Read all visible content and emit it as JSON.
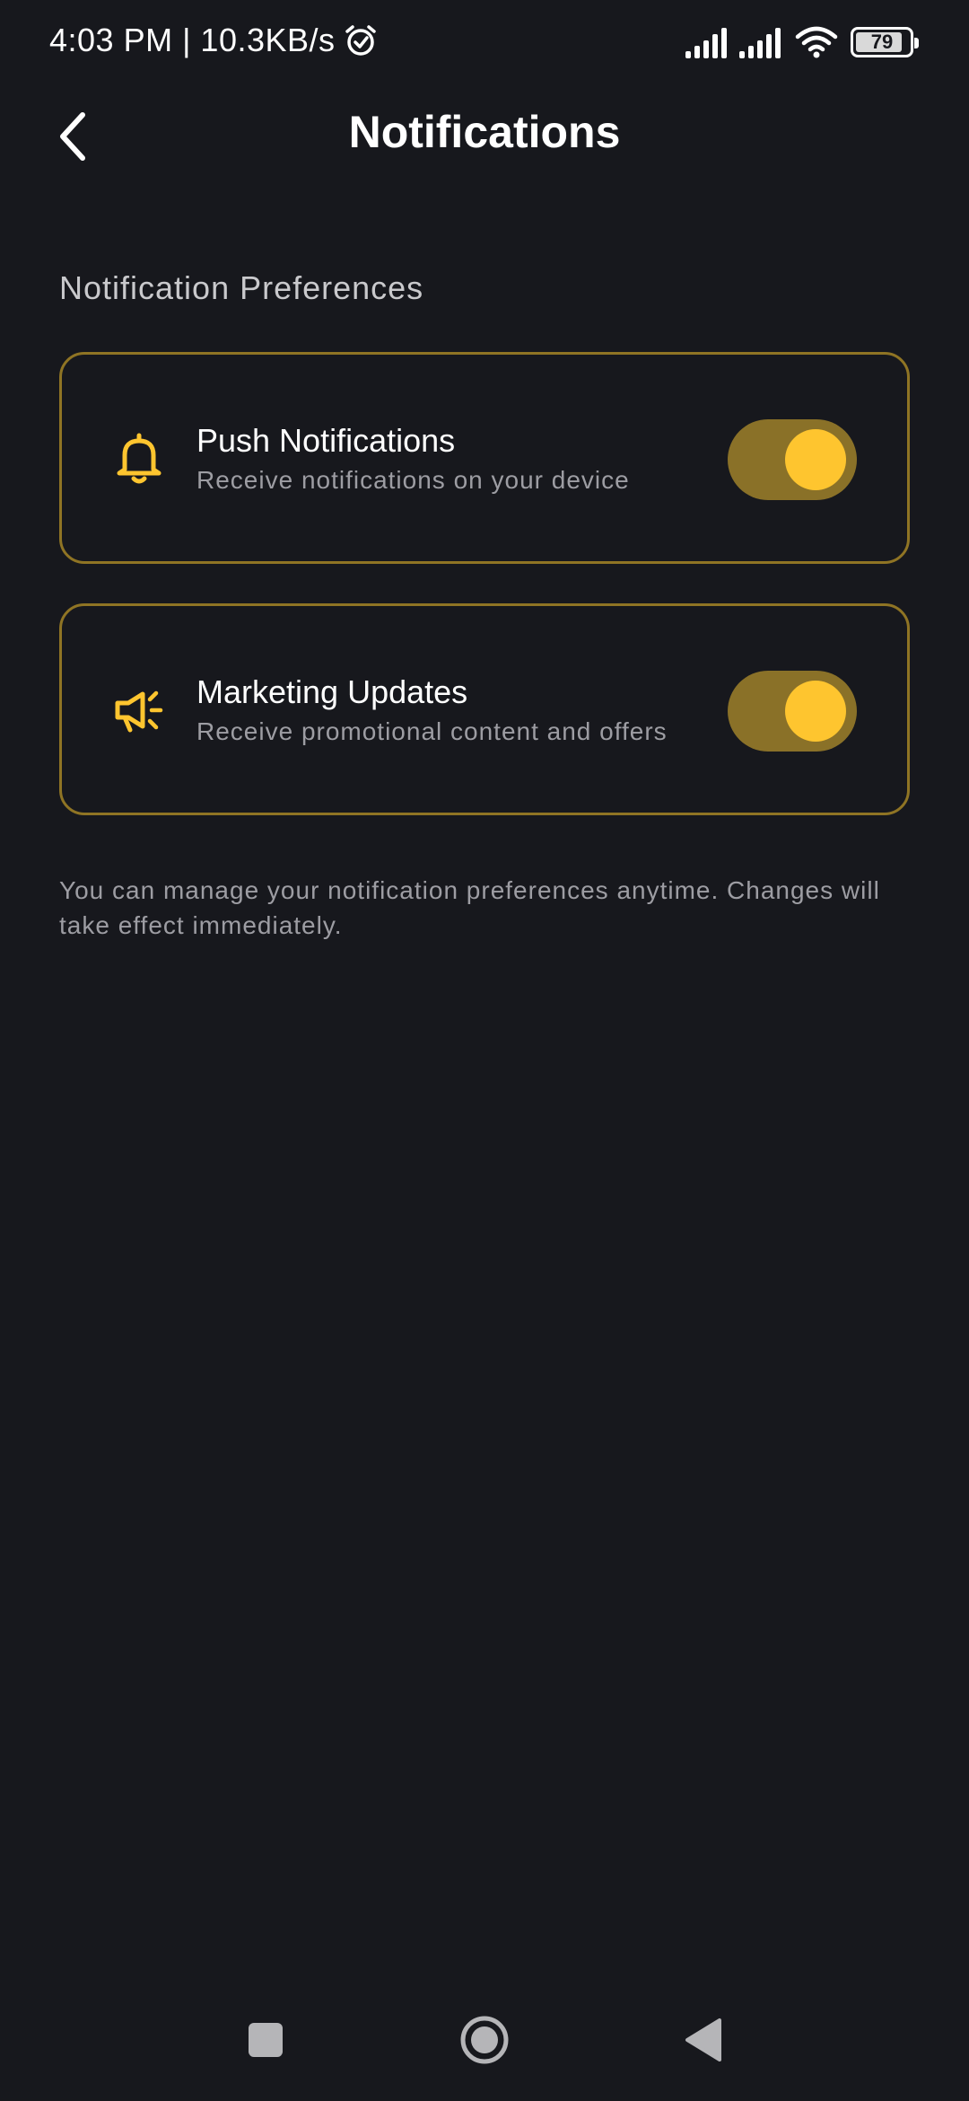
{
  "status_bar": {
    "time_speed": "4:03 PM | 10.3KB/s",
    "alarm_icon": "alarm-icon",
    "signal_icons": [
      "signal-icon",
      "signal-icon"
    ],
    "wifi_icon": "wifi-icon",
    "battery_level": "79"
  },
  "header": {
    "title": "Notifications",
    "back_icon": "chevron-left-icon"
  },
  "section": {
    "title": "Notification Preferences"
  },
  "preferences": [
    {
      "icon": "bell-icon",
      "title": "Push Notifications",
      "subtitle": "Receive notifications on your device",
      "enabled": true
    },
    {
      "icon": "megaphone-icon",
      "title": "Marketing Updates",
      "subtitle": "Receive promotional content and offers",
      "enabled": true
    }
  ],
  "info_text": "You can manage your notification preferences anytime. Changes will take effect immediately.",
  "nav_bar": {
    "recents_icon": "square-icon",
    "home_icon": "circle-icon",
    "back_icon": "triangle-back-icon"
  },
  "colors": {
    "background": "#17181d",
    "accent": "#fec52f",
    "toggle_track": "#8a7128",
    "card_border": "#8f7424",
    "secondary_text": "#9d9da3"
  }
}
